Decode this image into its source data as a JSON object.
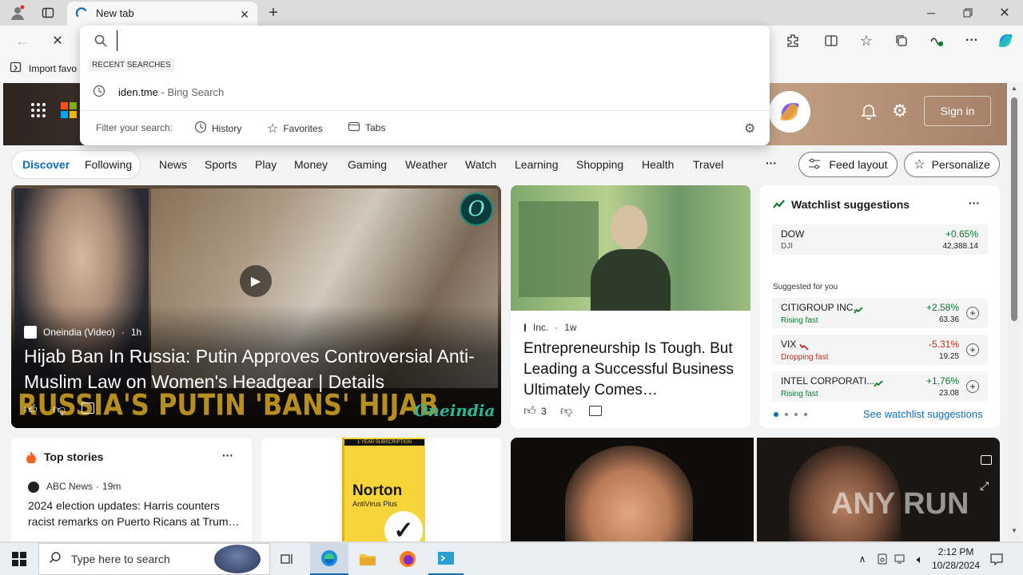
{
  "browser": {
    "tab_title": "New tab",
    "favorites_bar": {
      "import_label": "Import favo"
    }
  },
  "address": {
    "value": "",
    "recent_heading": "RECENT SEARCHES",
    "recent_item": {
      "query": "iden.tme",
      "suffix": "- Bing Search"
    },
    "filter_label": "Filter your search:",
    "filters": [
      "History",
      "Favorites",
      "Tabs"
    ]
  },
  "header": {
    "sign_in": "Sign in"
  },
  "nav": {
    "left_tabs": [
      "Discover",
      "Following"
    ],
    "items": [
      "News",
      "Sports",
      "Play",
      "Money",
      "Gaming",
      "Weather",
      "Watch",
      "Learning",
      "Shopping",
      "Health",
      "Travel"
    ],
    "more": "···",
    "feed_layout": "Feed layout",
    "personalize": "Personalize"
  },
  "hero_article": {
    "source": "Oneindia (Video)",
    "age": "1h",
    "title": "Hijab Ban In Russia: Putin Approves Controversial Anti-Muslim Law on Women's Headgear | Details",
    "banner": "RUSSIA'S PUTIN 'BANS' HIJAB",
    "brand": "Oneindia"
  },
  "article2": {
    "source": "Inc.",
    "age": "1w",
    "title": "Entrepreneurship Is Tough. But Leading a Successful Business Ultimately Comes…",
    "likes": "3"
  },
  "watchlist": {
    "title": "Watchlist suggestions",
    "dow": {
      "name": "DOW",
      "sub": "DJI",
      "change": "+0.65%",
      "value": "42,388.14"
    },
    "suggested_label": "Suggested for you",
    "stocks": [
      {
        "name": "CITIGROUP INC.",
        "status": "Rising fast",
        "change": "+2.58%",
        "value": "63.36"
      },
      {
        "name": "VIX",
        "status": "Dropping fast",
        "change": "-5.31%",
        "value": "19.25"
      },
      {
        "name": "INTEL CORPORATI...",
        "status": "Rising fast",
        "change": "+1.76%",
        "value": "23.08"
      }
    ],
    "link": "See watchlist suggestions"
  },
  "top_stories": {
    "title": "Top stories",
    "source": "ABC News",
    "age": "19m",
    "headline": "2024 election updates: Harris counters racist remarks on Puerto Ricans at Trum…"
  },
  "ad": {
    "top": "1 YEAR SUBSCRIPTION",
    "brand": "Norton",
    "product": "AntiVirus Plus"
  },
  "watermark": "ANY RUN",
  "taskbar": {
    "search_placeholder": "Type here to search",
    "time": "2:12 PM",
    "date": "10/28/2024"
  },
  "colors": {
    "accent": "#0f6cbd",
    "positive": "#0a7a2f",
    "negative": "#c42b1c"
  }
}
